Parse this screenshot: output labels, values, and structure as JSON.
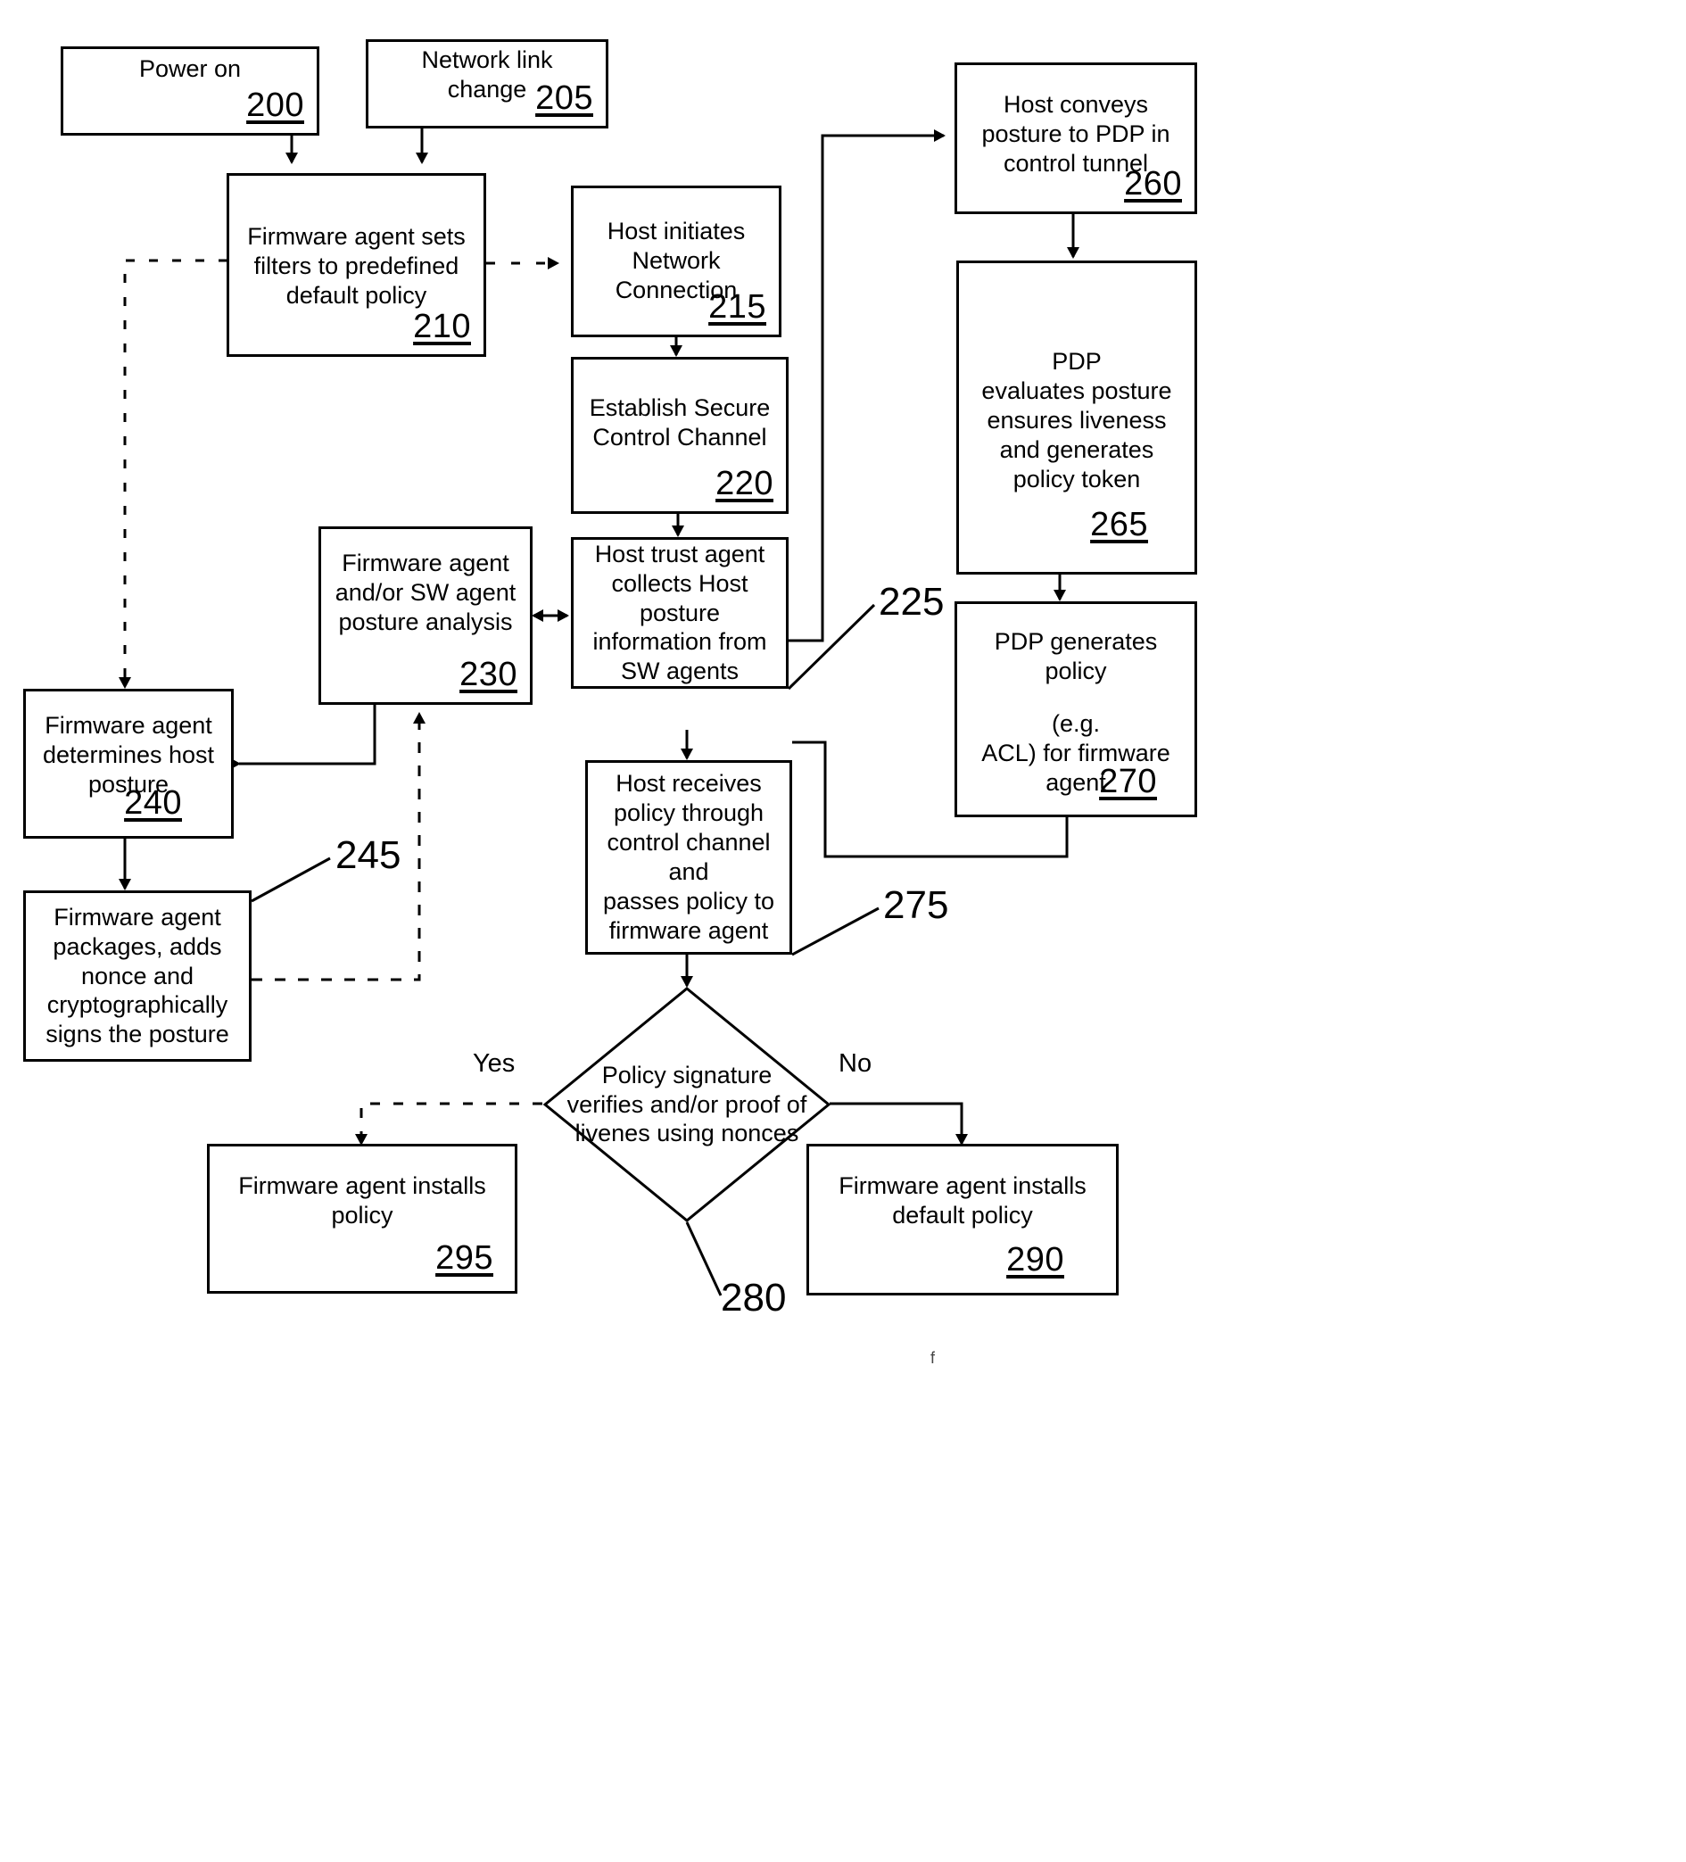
{
  "figure": {
    "type": "patent-flowchart",
    "nodes": [
      {
        "id": "n200",
        "num": "200",
        "text": "Power on",
        "shape": "rect"
      },
      {
        "id": "n205",
        "num": "205",
        "text": "Network link\nchange",
        "shape": "rect"
      },
      {
        "id": "n210",
        "num": "210",
        "text": "Firmware agent sets\nfilters to predefined\ndefault policy",
        "shape": "rect"
      },
      {
        "id": "n215",
        "num": "215",
        "text": "Host initiates\nNetwork\nConnection",
        "shape": "rect"
      },
      {
        "id": "n220",
        "num": "220",
        "text": "Establish Secure\nControl Channel",
        "shape": "rect"
      },
      {
        "id": "n230",
        "num": "230",
        "text": "Firmware agent\nand/or SW agent\nposture analysis",
        "shape": "rect"
      },
      {
        "id": "n225box",
        "num": "",
        "text": "Host trust agent\ncollects Host\nposture\ninformation from\nSW agents",
        "shape": "rect"
      },
      {
        "id": "n240",
        "num": "240",
        "text": "Firmware agent\ndetermines host\nposture",
        "shape": "rect"
      },
      {
        "id": "n245box",
        "num": "",
        "text": "Firmware agent\npackages, adds\nnonce and\ncryptographically\nsigns the posture",
        "shape": "rect"
      },
      {
        "id": "n260",
        "num": "260",
        "text": "Host conveys\nposture to PDP in\ncontrol tunnel",
        "shape": "rect"
      },
      {
        "id": "n265",
        "num": "265",
        "text": "PDP\nevaluates posture\nensures liveness\nand generates\npolicy token",
        "shape": "rect"
      },
      {
        "id": "n270",
        "num": "270",
        "text": "PDP generates\npolicy",
        "text2": "(e.g.\nACL)  for firmware\nagent",
        "shape": "rect"
      },
      {
        "id": "n275box",
        "num": "",
        "text": "Host receives\npolicy through\ncontrol channel and\npasses policy to\nfirmware agent",
        "shape": "rect"
      },
      {
        "id": "n280",
        "num": "280",
        "text": "Policy  signature\nverifies and/or proof  of\nlivenes using nonces",
        "shape": "diamond"
      },
      {
        "id": "n295",
        "num": "295",
        "text": "Firmware agent installs\npolicy",
        "shape": "rect"
      },
      {
        "id": "n290",
        "num": "290",
        "text": "Firmware agent installs\ndefault policy",
        "shape": "rect"
      }
    ],
    "reference_labels": [
      {
        "id": "r225",
        "text": "225"
      },
      {
        "id": "r245",
        "text": "245"
      },
      {
        "id": "r275",
        "text": "275"
      },
      {
        "id": "r280",
        "text": "280"
      }
    ],
    "branch_labels": [
      {
        "id": "yes",
        "text": "Yes"
      },
      {
        "id": "no",
        "text": "No"
      }
    ],
    "stray_mark": "f",
    "colors": {
      "ink": "#000000",
      "paper": "#ffffff"
    }
  }
}
